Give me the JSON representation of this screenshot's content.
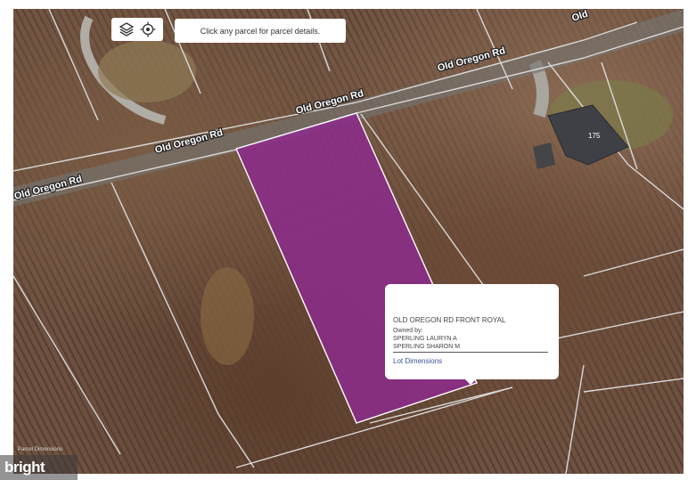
{
  "map": {
    "road_labels": [
      "Old Oregon Rd",
      "Old Oregon Rd",
      "Old Oregon Rd",
      "Old Oregon Rd",
      "Old"
    ],
    "house_number": "175",
    "selected_parcel_color": "#8c2b8c",
    "parcel_line_color": "#d9d9d9"
  },
  "toolbar": {
    "layers_icon": "layers-icon",
    "locate_icon": "crosshair-icon"
  },
  "hint": {
    "text": "Click any parcel for parcel details."
  },
  "popup": {
    "address": "OLD OREGON RD FRONT ROYAL",
    "owned_by_label": "Owned by:",
    "owners": [
      "SPERLING LAURYN A",
      "SPERLING SHARON M"
    ],
    "link_label": "Lot Dimensions"
  },
  "attribution": "Parcel Dimensions",
  "branding": {
    "logo_text": "bright"
  }
}
